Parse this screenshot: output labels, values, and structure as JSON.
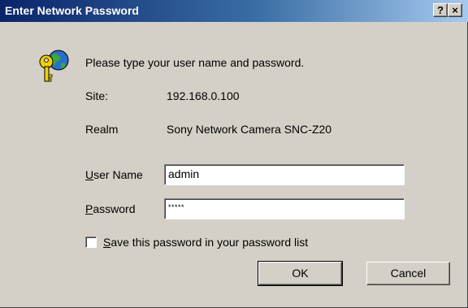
{
  "window": {
    "title": "Enter Network Password",
    "help_label": "?",
    "close_label": "×"
  },
  "message": "Please type your user name and password.",
  "site": {
    "label": "Site:",
    "value": "192.168.0.100"
  },
  "realm": {
    "label": "Realm",
    "value": "Sony Network Camera SNC-Z20"
  },
  "username": {
    "label_first": "U",
    "label_rest": "ser Name",
    "value": "admin"
  },
  "password": {
    "label_first": "P",
    "label_rest": "assword",
    "value": "*****"
  },
  "save_checkbox": {
    "label_first": "S",
    "label_rest": "ave this password in your password list",
    "checked": false
  },
  "buttons": {
    "ok": "OK",
    "cancel": "Cancel"
  },
  "icons": {
    "dialog_icon": "keys-globe-icon"
  }
}
